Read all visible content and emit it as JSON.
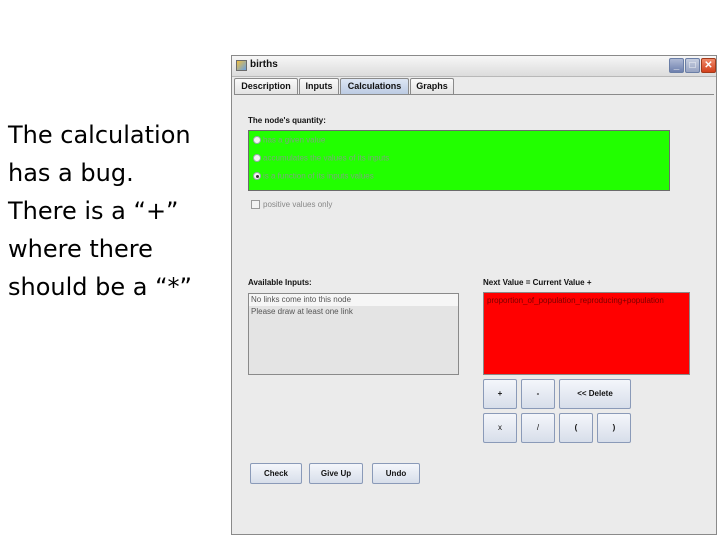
{
  "caption": {
    "lines": [
      "The calculation",
      "has a bug.",
      "There is a “+”",
      "where there",
      "should be a “*”"
    ]
  },
  "window": {
    "title": "births",
    "icon": "java-app-icon",
    "controls": {
      "minimize": "_",
      "maximize": "□",
      "close": "✕"
    }
  },
  "tabs": [
    {
      "label": "Description",
      "active": false
    },
    {
      "label": "Inputs",
      "active": false
    },
    {
      "label": "Calculations",
      "active": true
    },
    {
      "label": "Graphs",
      "active": false
    }
  ],
  "quantity": {
    "label": "The node's quantity:",
    "options": [
      {
        "label": "has a given value",
        "selected": false
      },
      {
        "label": "accumulates the values of its inputs",
        "selected": false
      },
      {
        "label": "is a function of its inputs values",
        "selected": true
      }
    ],
    "highlight_color": "#22ff00"
  },
  "positive_only": {
    "label": "positive values only",
    "checked": false
  },
  "available_inputs": {
    "label": "Available Inputs:",
    "items": [
      "No links come into this node",
      "Please draw at least one link"
    ]
  },
  "equation": {
    "label": "Next Value = Current Value +",
    "expression": "proportion_of_population_reproducing+population",
    "error_color": "#ff0000"
  },
  "operators": {
    "plus": "+",
    "minus": "-",
    "delete": "<< Delete",
    "times": "x",
    "divide": "/",
    "open_paren": "(",
    "close_paren": ")"
  },
  "actions": {
    "check": "Check",
    "give_up": "Give Up",
    "undo": "Undo"
  }
}
